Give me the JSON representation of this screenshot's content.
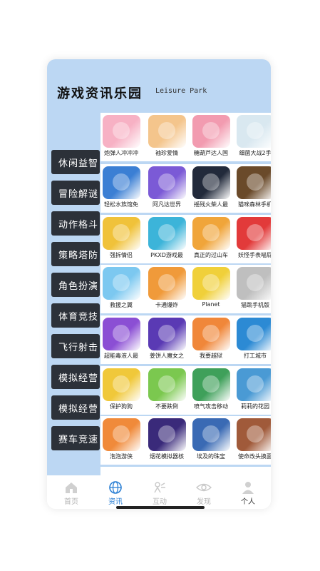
{
  "header": {
    "title": "游戏资讯乐园",
    "subtitle": "Leisure Park"
  },
  "categories": [
    "休闲益智",
    "冒险解谜",
    "动作格斗",
    "策略塔防",
    "角色扮演",
    "体育竞技",
    "飞行射击",
    "模拟经营",
    "模拟经营",
    "赛车竞速"
  ],
  "games": [
    [
      "炮弹人冲冲冲",
      "袖珍爱情",
      "糖葫芦达人国",
      "细菌大战2手"
    ],
    [
      "轻松水族馆免",
      "阿凡达世界",
      "摇残火柴人最",
      "猫咪森林手机"
    ],
    [
      "强拆情侣",
      "PKXD游戏最",
      "真正的过山车",
      "妖怪手表喵屁"
    ],
    [
      "救援之翼",
      "卡通爆炸",
      "Planet",
      "猫跳手机版"
    ],
    [
      "超能毒液人最",
      "姜饼人魔女之",
      "我要越狱",
      "打工城市"
    ],
    [
      "保护狗狗",
      "不要跌倒",
      "喷气攻击移动",
      "莉莉的花园"
    ],
    [
      "泡泡游侠",
      "烟花模拟器核",
      "埃及的珠宝",
      "使命改头换面"
    ]
  ],
  "tabs": [
    {
      "label": "首页",
      "icon": "home-icon"
    },
    {
      "label": "资讯",
      "icon": "globe-icon"
    },
    {
      "label": "互动",
      "icon": "interact-icon"
    },
    {
      "label": "发现",
      "icon": "eye-icon"
    },
    {
      "label": "个人",
      "icon": "user-icon"
    }
  ],
  "colors": {
    "accent": "#2a7fd4",
    "panel": "#bcd7f3",
    "category_bg": "#2c3139"
  }
}
